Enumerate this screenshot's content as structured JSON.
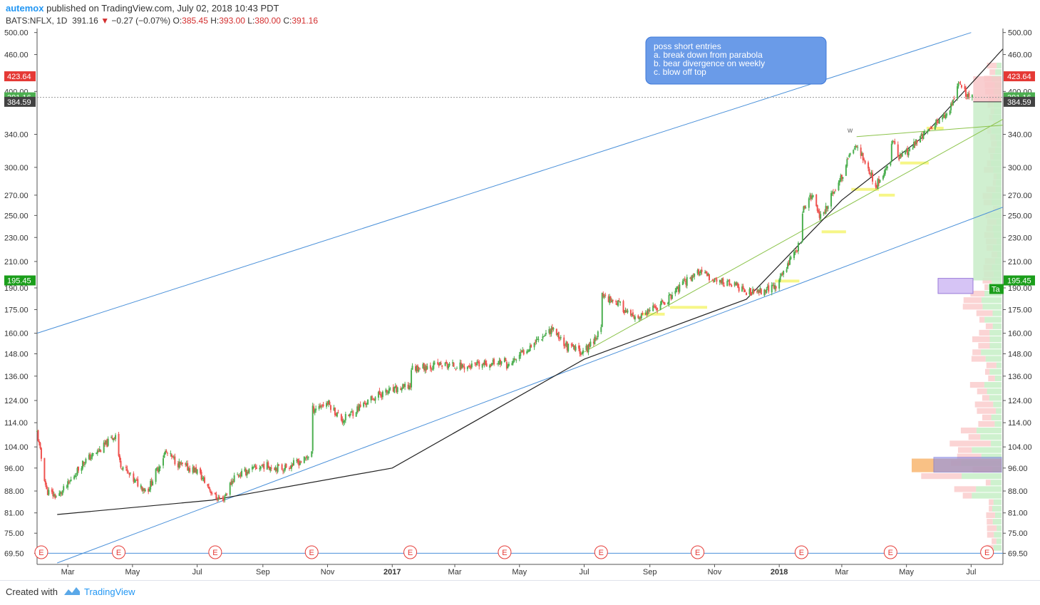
{
  "header": {
    "author": "autemox",
    "published_text": "published on TradingView.com, July 02, 2018 10:43 PDT",
    "symbol": "BATS:NFLX, 1D",
    "last": "391.16",
    "change": "−0.27 (−0.07%)",
    "o_label": "O:",
    "o_val": "385.45",
    "h_label": "H:",
    "h_val": "393.00",
    "l_label": "L:",
    "l_val": "380.00",
    "c_label": "C:",
    "c_val": "391.16"
  },
  "footer": {
    "created_with": "Created with",
    "brand": "TradingView"
  },
  "annotation": {
    "lines": [
      "poss short entries",
      "a. break down from parabola",
      "b. bear divergence on weekly",
      "c. blow off top"
    ]
  },
  "price_badges": [
    {
      "label": "423.64",
      "price": 423.64,
      "color": "#e53935"
    },
    {
      "label": "391.16",
      "price": 391.16,
      "color": "#4caf50"
    },
    {
      "label": "384.59",
      "price": 384.59,
      "color": "#424242"
    },
    {
      "label": "195.45",
      "price": 195.45,
      "color": "#1b9e1b"
    }
  ],
  "target_label": "Ta",
  "w_label": "w",
  "earnings_marker": "E",
  "colors": {
    "up": "#26a69a",
    "up_fill": "#4caf50",
    "down": "#ef5350",
    "channel": "#4a90d9",
    "parabola": "#222222",
    "note_bg": "#6a9be8"
  },
  "chart_data": {
    "type": "candlestick",
    "title": "",
    "y_scale": "log",
    "ylim": [
      67,
      505
    ],
    "y_ticks": [
      500,
      460,
      400,
      340,
      300,
      270,
      250,
      230,
      210,
      190,
      175,
      160,
      148,
      136,
      124,
      114,
      104,
      96,
      88,
      81,
      75,
      69.5
    ],
    "y_tick_labels": [
      "500.00",
      "460.00",
      "400.00",
      "340.00",
      "300.00",
      "270.00",
      "250.00",
      "230.00",
      "210.00",
      "190.00",
      "175.00",
      "160.00",
      "148.00",
      "136.00",
      "124.00",
      "114.00",
      "104.00",
      "96.00",
      "88.00",
      "81.00",
      "75.00",
      "69.50"
    ],
    "x_range": [
      "2016-02-01",
      "2018-07-31"
    ],
    "x_ticks": [
      {
        "date": "2016-03-01",
        "label": "Mar"
      },
      {
        "date": "2016-05-01",
        "label": "May"
      },
      {
        "date": "2016-07-01",
        "label": "Jul"
      },
      {
        "date": "2016-09-01",
        "label": "Sep"
      },
      {
        "date": "2016-11-01",
        "label": "Nov"
      },
      {
        "date": "2017-01-01",
        "label": "2017"
      },
      {
        "date": "2017-03-01",
        "label": "Mar"
      },
      {
        "date": "2017-05-01",
        "label": "May"
      },
      {
        "date": "2017-07-01",
        "label": "Jul"
      },
      {
        "date": "2017-09-01",
        "label": "Sep"
      },
      {
        "date": "2017-11-01",
        "label": "Nov"
      },
      {
        "date": "2018-01-01",
        "label": "2018"
      },
      {
        "date": "2018-03-01",
        "label": "Mar"
      },
      {
        "date": "2018-05-01",
        "label": "May"
      },
      {
        "date": "2018-07-01",
        "label": "Jul"
      }
    ],
    "earnings_dates": [
      "2016-02-05",
      "2016-04-18",
      "2016-07-18",
      "2016-10-17",
      "2017-01-18",
      "2017-04-17",
      "2017-07-17",
      "2017-10-16",
      "2018-01-22",
      "2018-04-16",
      "2018-07-16"
    ],
    "price_path": [
      [
        "2016-02-01",
        110
      ],
      [
        "2016-02-10",
        88
      ],
      [
        "2016-02-20",
        86
      ],
      [
        "2016-03-01",
        90
      ],
      [
        "2016-03-15",
        98
      ],
      [
        "2016-04-01",
        103
      ],
      [
        "2016-04-15",
        109
      ],
      [
        "2016-04-19",
        98
      ],
      [
        "2016-05-01",
        92
      ],
      [
        "2016-05-15",
        88
      ],
      [
        "2016-06-01",
        102
      ],
      [
        "2016-06-15",
        97
      ],
      [
        "2016-07-01",
        95
      ],
      [
        "2016-07-18",
        86
      ],
      [
        "2016-07-25",
        85
      ],
      [
        "2016-08-05",
        93
      ],
      [
        "2016-09-01",
        97
      ],
      [
        "2016-09-20",
        96
      ],
      [
        "2016-10-10",
        99
      ],
      [
        "2016-10-17",
        102
      ],
      [
        "2016-10-18",
        120
      ],
      [
        "2016-11-01",
        123
      ],
      [
        "2016-11-15",
        115
      ],
      [
        "2016-12-01",
        121
      ],
      [
        "2016-12-20",
        127
      ],
      [
        "2017-01-18",
        131
      ],
      [
        "2017-01-19",
        140
      ],
      [
        "2017-02-15",
        142
      ],
      [
        "2017-03-15",
        141
      ],
      [
        "2017-04-17",
        144
      ],
      [
        "2017-04-20",
        141
      ],
      [
        "2017-05-15",
        155
      ],
      [
        "2017-06-01",
        163
      ],
      [
        "2017-06-15",
        152
      ],
      [
        "2017-07-01",
        149
      ],
      [
        "2017-07-17",
        162
      ],
      [
        "2017-07-18",
        185
      ],
      [
        "2017-08-01",
        180
      ],
      [
        "2017-08-18",
        168
      ],
      [
        "2017-09-15",
        180
      ],
      [
        "2017-10-05",
        195
      ],
      [
        "2017-10-16",
        202
      ],
      [
        "2017-11-01",
        196
      ],
      [
        "2017-11-20",
        192
      ],
      [
        "2017-12-05",
        186
      ],
      [
        "2017-12-29",
        191
      ],
      [
        "2018-01-10",
        210
      ],
      [
        "2018-01-22",
        227
      ],
      [
        "2018-01-23",
        255
      ],
      [
        "2018-02-01",
        270
      ],
      [
        "2018-02-08",
        248
      ],
      [
        "2018-02-15",
        260
      ],
      [
        "2018-03-01",
        290
      ],
      [
        "2018-03-12",
        325
      ],
      [
        "2018-03-20",
        315
      ],
      [
        "2018-04-02",
        280
      ],
      [
        "2018-04-10",
        295
      ],
      [
        "2018-04-16",
        305
      ],
      [
        "2018-04-17",
        333
      ],
      [
        "2018-04-25",
        310
      ],
      [
        "2018-05-10",
        330
      ],
      [
        "2018-05-25",
        350
      ],
      [
        "2018-06-10",
        370
      ],
      [
        "2018-06-20",
        415
      ],
      [
        "2018-06-25",
        399
      ],
      [
        "2018-07-02",
        391.16
      ]
    ],
    "last_bar": {
      "open": 385.45,
      "high": 393.0,
      "low": 380.0,
      "close": 391.16,
      "change": -0.27,
      "change_pct": -0.07
    },
    "trendlines": [
      {
        "name": "upper-channel",
        "color": "#4a90d9",
        "from": [
          "2016-02-01",
          160
        ],
        "to": [
          "2018-07-01",
          500
        ]
      },
      {
        "name": "lower-channel",
        "color": "#4a90d9",
        "from": [
          "2016-02-20",
          67
        ],
        "to": [
          "2018-07-31",
          258
        ]
      },
      {
        "name": "green-trend-1",
        "color": "#8bc34a",
        "from": [
          "2017-07-01",
          149
        ],
        "to": [
          "2018-07-31",
          360
        ]
      },
      {
        "name": "green-trend-2",
        "color": "#8bc34a",
        "from": [
          "2018-03-15",
          337
        ],
        "to": [
          "2018-07-31",
          352
        ]
      }
    ],
    "parabola": {
      "color": "#222222",
      "start": [
        "2016-02-20",
        80.5
      ],
      "points": [
        [
          "2016-07-15",
          85
        ],
        [
          "2017-01-01",
          96
        ],
        [
          "2017-07-01",
          145
        ],
        [
          "2017-12-01",
          182
        ],
        [
          "2018-03-01",
          265
        ],
        [
          "2018-05-15",
          335
        ],
        [
          "2018-07-31",
          470
        ]
      ]
    },
    "horizontal_line": {
      "price": 69.5,
      "color": "#4a90d9"
    },
    "position": {
      "entry": 384.59,
      "stop": 423.64,
      "target": 195.45,
      "start_date": "2018-07-03",
      "end_date": "2018-07-31"
    }
  }
}
